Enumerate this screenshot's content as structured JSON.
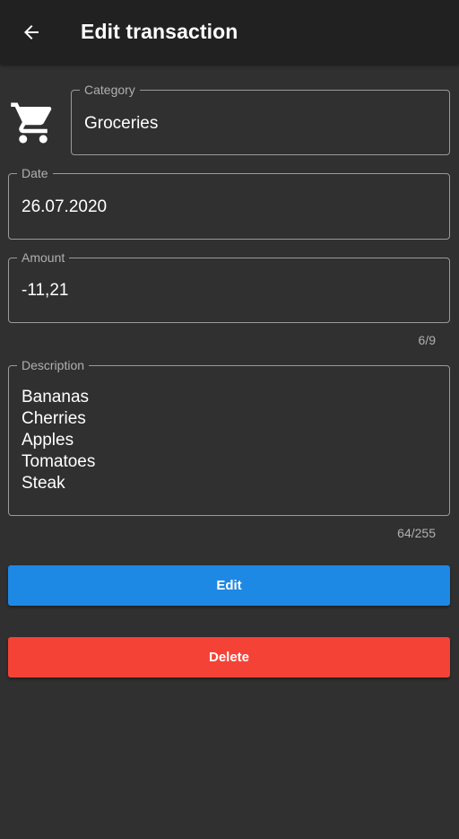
{
  "appbar": {
    "title": "Edit transaction",
    "back_icon": "arrow-left-icon"
  },
  "category": {
    "label": "Category",
    "value": "Groceries",
    "icon": "shopping-cart-icon"
  },
  "date": {
    "label": "Date",
    "value": "26.07.2020"
  },
  "amount": {
    "label": "Amount",
    "value": "-11,21",
    "counter": "6/9"
  },
  "description": {
    "label": "Description",
    "lines": [
      "Bananas",
      "Cherries",
      "Apples",
      "Tomatoes",
      "Steak"
    ],
    "counter": "64/255"
  },
  "buttons": {
    "edit_label": "Edit",
    "delete_label": "Delete"
  },
  "colors": {
    "background": "#303030",
    "appbar": "#212121",
    "edit": "#1e88e5",
    "delete": "#f44336"
  }
}
